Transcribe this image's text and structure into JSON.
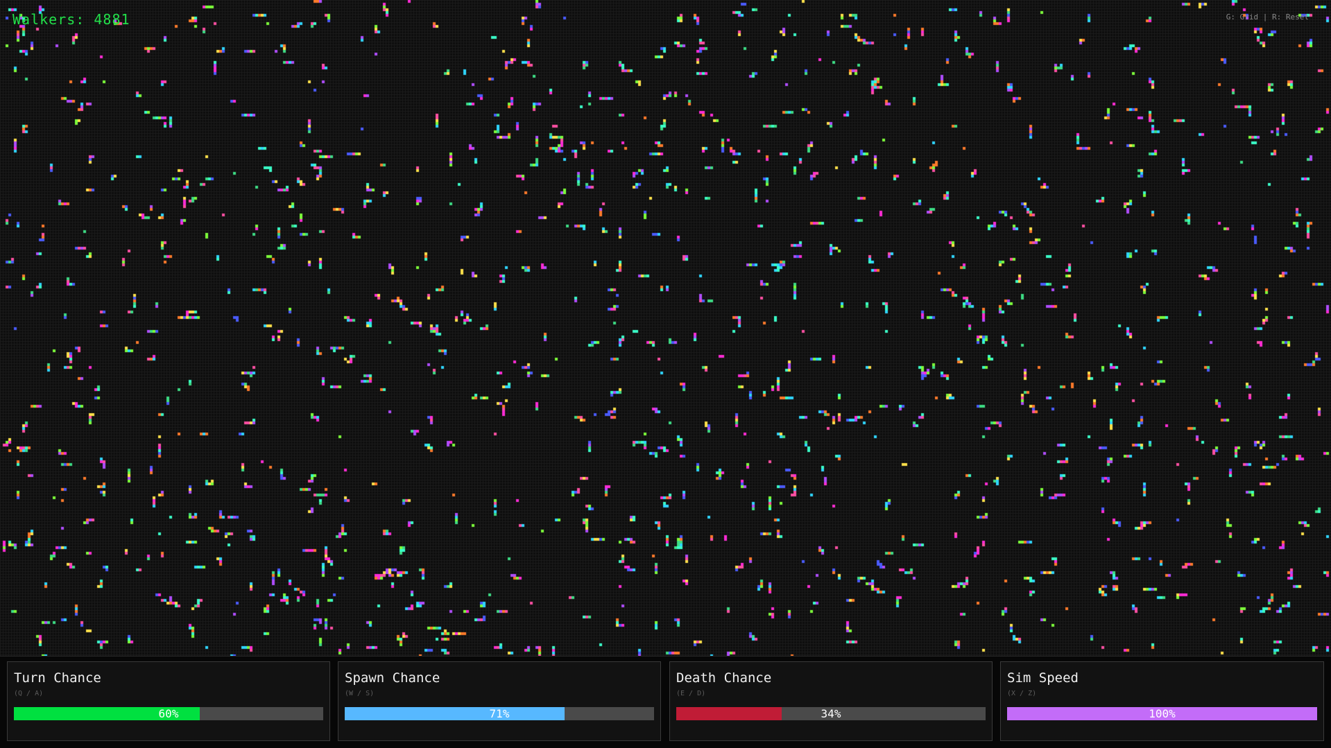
{
  "hud": {
    "walkers_label": "Walkers: 4881",
    "hint": "G: Grid | R: Reset"
  },
  "grid": {
    "background": "#0d0d0d",
    "grid_line_color": "#1c1c1c",
    "walker_colors": [
      "#ff2bd6",
      "#ff4fa3",
      "#3ddc84",
      "#2fd6ff",
      "#4a5bff",
      "#b04cff",
      "#ffe14a",
      "#7dff3a",
      "#ff7a2a",
      "#3affc8"
    ]
  },
  "controls": [
    {
      "id": "turn",
      "title": "Turn Chance",
      "keys": "(Q / A)",
      "value_label": "60%",
      "value": 0.6,
      "color": "#00e040"
    },
    {
      "id": "spawn",
      "title": "Spawn Chance",
      "keys": "(W / S)",
      "value_label": "71%",
      "value": 0.71,
      "color": "#57b8ff"
    },
    {
      "id": "death",
      "title": "Death Chance",
      "keys": "(E / D)",
      "value_label": "34%",
      "value": 0.34,
      "color": "#c01c36"
    },
    {
      "id": "speed",
      "title": "Sim Speed",
      "keys": "(X / Z)",
      "value_label": "100%",
      "value": 1.0,
      "color": "#c36cf8"
    }
  ]
}
